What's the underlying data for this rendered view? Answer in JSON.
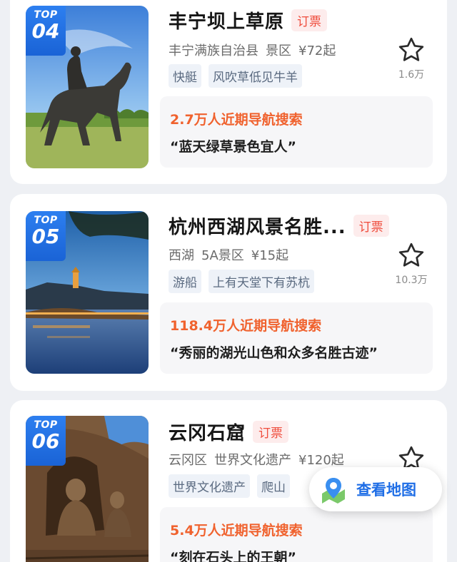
{
  "colors": {
    "badge_blue": "#1f6ee6",
    "ticket_red": "#ef4c3c",
    "search_orange": "#f0622e",
    "background": "#eef0f4"
  },
  "items": [
    {
      "rank_top": "TOP",
      "rank": "04",
      "title": "丰宁坝上草原",
      "ticket_label": "订票",
      "region": "丰宁满族自治县",
      "level": "景区",
      "price": "¥72起",
      "tags": [
        "快艇",
        "风吹草低见牛羊"
      ],
      "fav_count": "1.6万",
      "search_text": "2.7万人近期导航搜索",
      "quote": "“蓝天绿草景色宜人”",
      "image_icon": "horse-statue-image"
    },
    {
      "rank_top": "TOP",
      "rank": "05",
      "title": "杭州西湖风景名胜...",
      "ticket_label": "订票",
      "region": "西湖",
      "level": "5A景区",
      "price": "¥15起",
      "tags": [
        "游船",
        "上有天堂下有苏杭"
      ],
      "fav_count": "10.3万",
      "search_text": "118.4万人近期导航搜索",
      "quote": "“秀丽的湖光山色和众多名胜古迹”",
      "image_icon": "west-lake-image"
    },
    {
      "rank_top": "TOP",
      "rank": "06",
      "title": "云冈石窟",
      "ticket_label": "订票",
      "region": "云冈区",
      "level": "世界文化遗产",
      "price": "¥120起",
      "tags": [
        "世界文化遗产",
        "爬山"
      ],
      "fav_count": "",
      "search_text": "5.4万人近期导航搜索",
      "quote": "“刻在石头上的王朝”",
      "image_icon": "grotto-buddha-image"
    }
  ],
  "map_button": {
    "label": "查看地图",
    "icon": "map-pin-icon"
  }
}
